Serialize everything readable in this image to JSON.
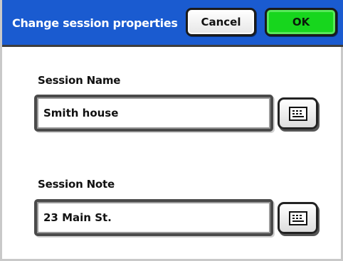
{
  "header": {
    "title": "Change session properties",
    "cancel_label": "Cancel",
    "ok_label": "OK"
  },
  "fields": [
    {
      "label": "Session Name",
      "value": "Smith house"
    },
    {
      "label": "Session Note",
      "value": "23 Main St."
    }
  ],
  "icons": {
    "keyboard": "keyboard-icon"
  },
  "colors": {
    "header_bg": "#1a5bd0",
    "ok_green": "#17d61d",
    "border_dark": "#4a4a4a"
  }
}
